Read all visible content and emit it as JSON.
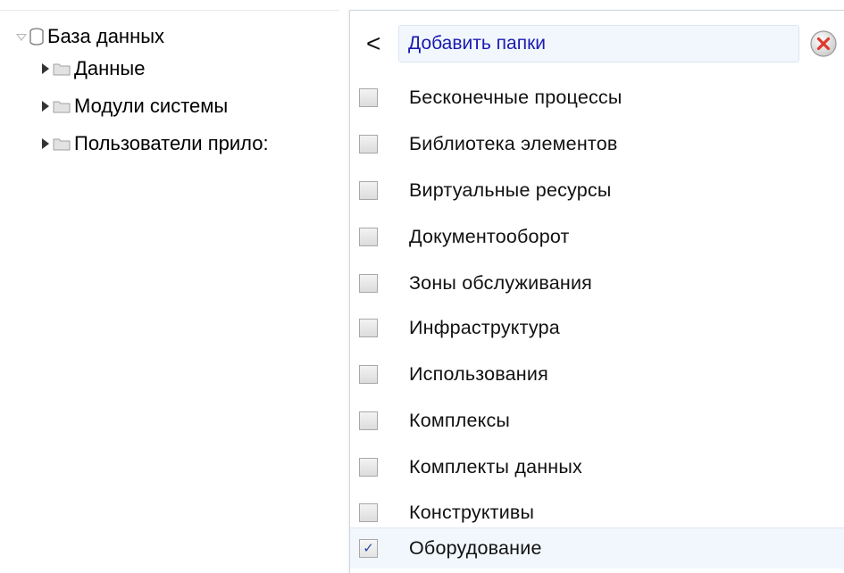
{
  "tree": {
    "root_label": "База данных",
    "root_icon": "database-icon",
    "children": [
      {
        "label": "Данные",
        "icon": "folder-icon"
      },
      {
        "label": "Модули системы",
        "icon": "folder-icon"
      },
      {
        "label": "Пользователи прило:",
        "icon": "folder-icon"
      }
    ]
  },
  "panel": {
    "back_glyph": "<",
    "search_text": "Добавить папки",
    "close_icon": "close-icon",
    "accent_color": "#1a1ab0",
    "selected_bg": "#f1f7fd",
    "items": [
      {
        "label": "Бесконечные процессы",
        "checked": false
      },
      {
        "label": "Библиотека элементов",
        "checked": false
      },
      {
        "label": "Виртуальные ресурсы",
        "checked": false
      },
      {
        "label": "Документооборот",
        "checked": false
      },
      {
        "label": "Зоны обслуживания",
        "checked": false
      },
      {
        "label": "Инфраструктура",
        "checked": false
      },
      {
        "label": "Использования",
        "checked": false
      },
      {
        "label": "Комплексы",
        "checked": false
      },
      {
        "label": "Комплекты данных",
        "checked": false
      },
      {
        "label": "Конструктивы",
        "checked": false
      },
      {
        "label": "Оборудование",
        "checked": true
      }
    ]
  }
}
